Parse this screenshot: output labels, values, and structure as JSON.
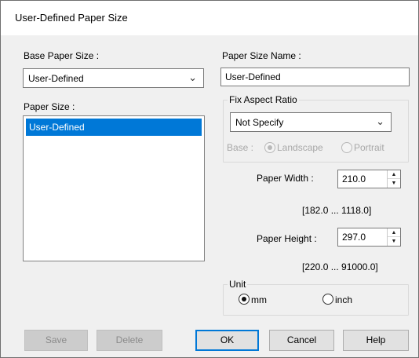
{
  "window": {
    "title": "User-Defined Paper Size"
  },
  "base_paper_size": {
    "label": "Base Paper Size :",
    "value": "User-Defined"
  },
  "paper_size_name": {
    "label": "Paper Size Name :",
    "value": "User-Defined"
  },
  "paper_size": {
    "label": "Paper Size :",
    "items": [
      "User-Defined"
    ]
  },
  "fix_aspect_ratio": {
    "label": "Fix Aspect Ratio",
    "value": "Not Specify",
    "base_label": "Base :",
    "landscape_label": "Landscape",
    "portrait_label": "Portrait"
  },
  "paper_width": {
    "label": "Paper Width  :",
    "value": "210.0",
    "range": "[182.0 ... 1118.0]"
  },
  "paper_height": {
    "label": "Paper Height :",
    "value": "297.0",
    "range": "[220.0 ... 91000.0]"
  },
  "unit": {
    "label": "Unit",
    "mm_label": "mm",
    "inch_label": "inch"
  },
  "buttons": {
    "save": "Save",
    "delete": "Delete",
    "ok": "OK",
    "cancel": "Cancel",
    "help": "Help"
  },
  "icons": {
    "chevron": "chevron-down-icon",
    "spin_up": "spin-up-icon",
    "spin_down": "spin-down-icon"
  }
}
